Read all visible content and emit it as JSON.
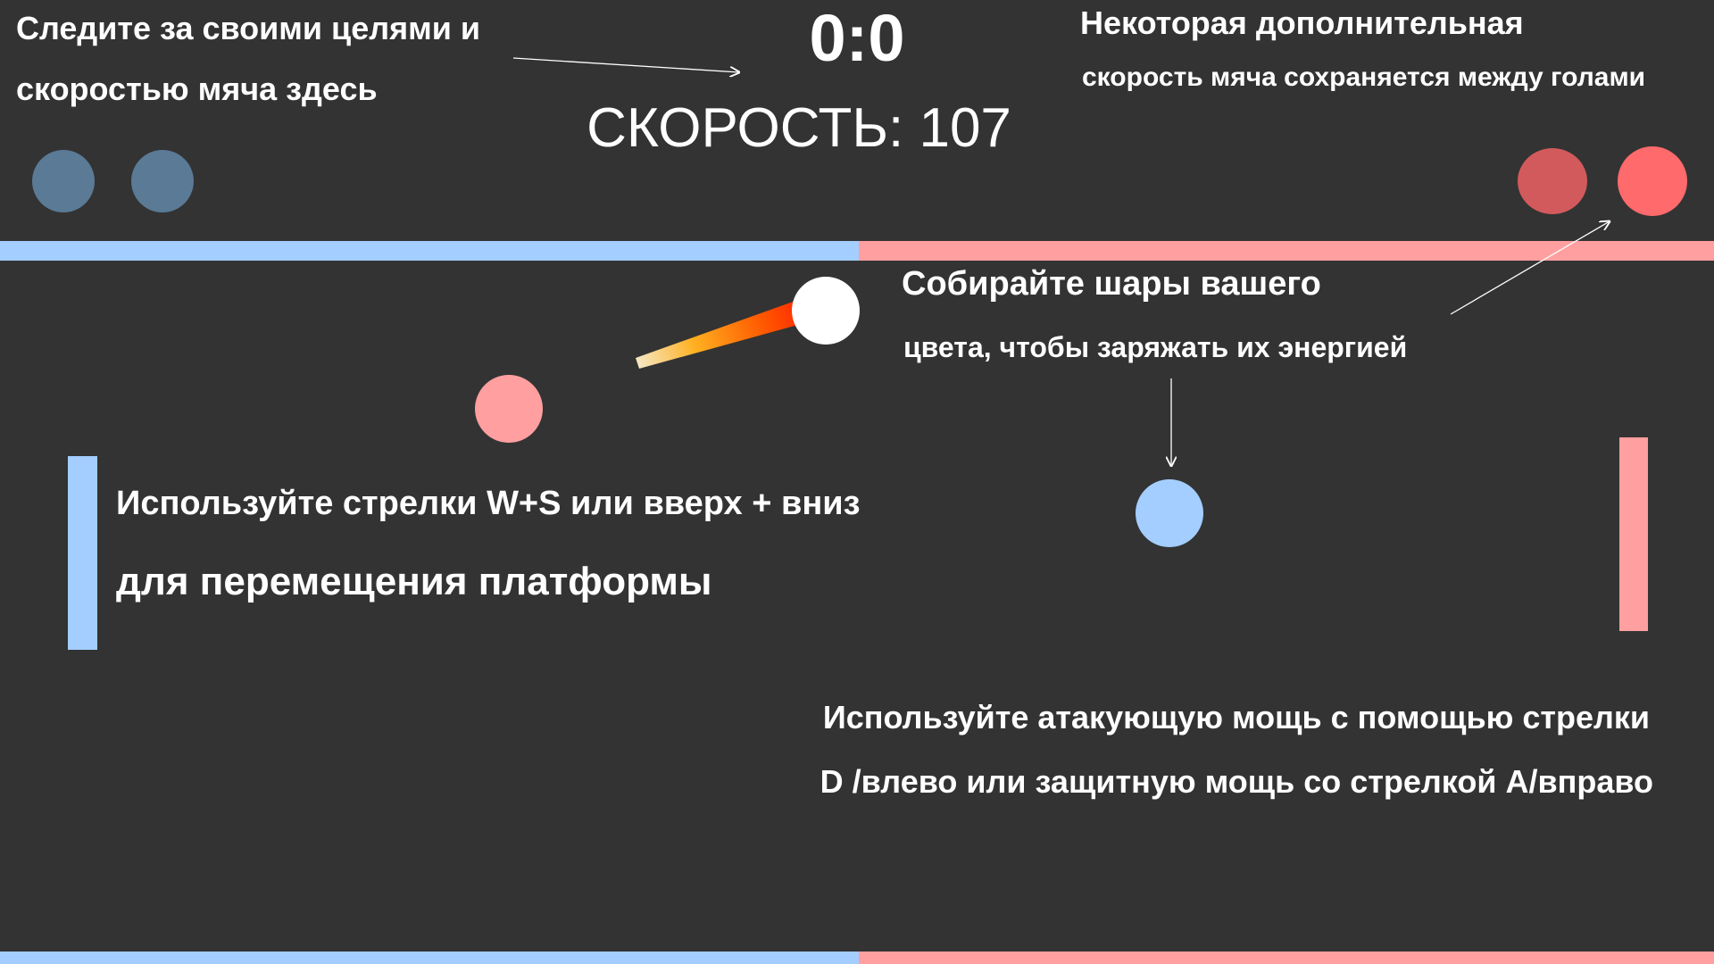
{
  "hud": {
    "score": "0:0",
    "speed_label": "СКОРОСТЬ: 107"
  },
  "tips": {
    "track_line1": "Следите за своими целями и",
    "track_line2": "скоростью мяча здесь",
    "extra_line1": "Некоторая дополнительная",
    "extra_line2": "скорость мяча сохраняется между голами",
    "collect_line1": "Собирайте шары вашего",
    "collect_line2": "цвета, чтобы заряжать их энергией",
    "move_line1": "Используйте стрелки W+S или вверх + вниз",
    "move_line2": "для перемещения платформы",
    "power_line1": "Используйте атакующую мощь с помощью стрелки",
    "power_line2": "D /влево или защитную мощь со стрелкой A/вправо"
  },
  "colors": {
    "background": "#333333",
    "blue_team": "#a3ceff",
    "red_team": "#ff9fa0",
    "blue_goal_dot": "#5a7a96",
    "red_goal_dot_dim": "#d35a5c",
    "red_goal_dot_bright": "#ff6a6c",
    "ball": "#ffffff",
    "trail_start": "#ff2a00",
    "trail_end": "#fff2d0"
  }
}
